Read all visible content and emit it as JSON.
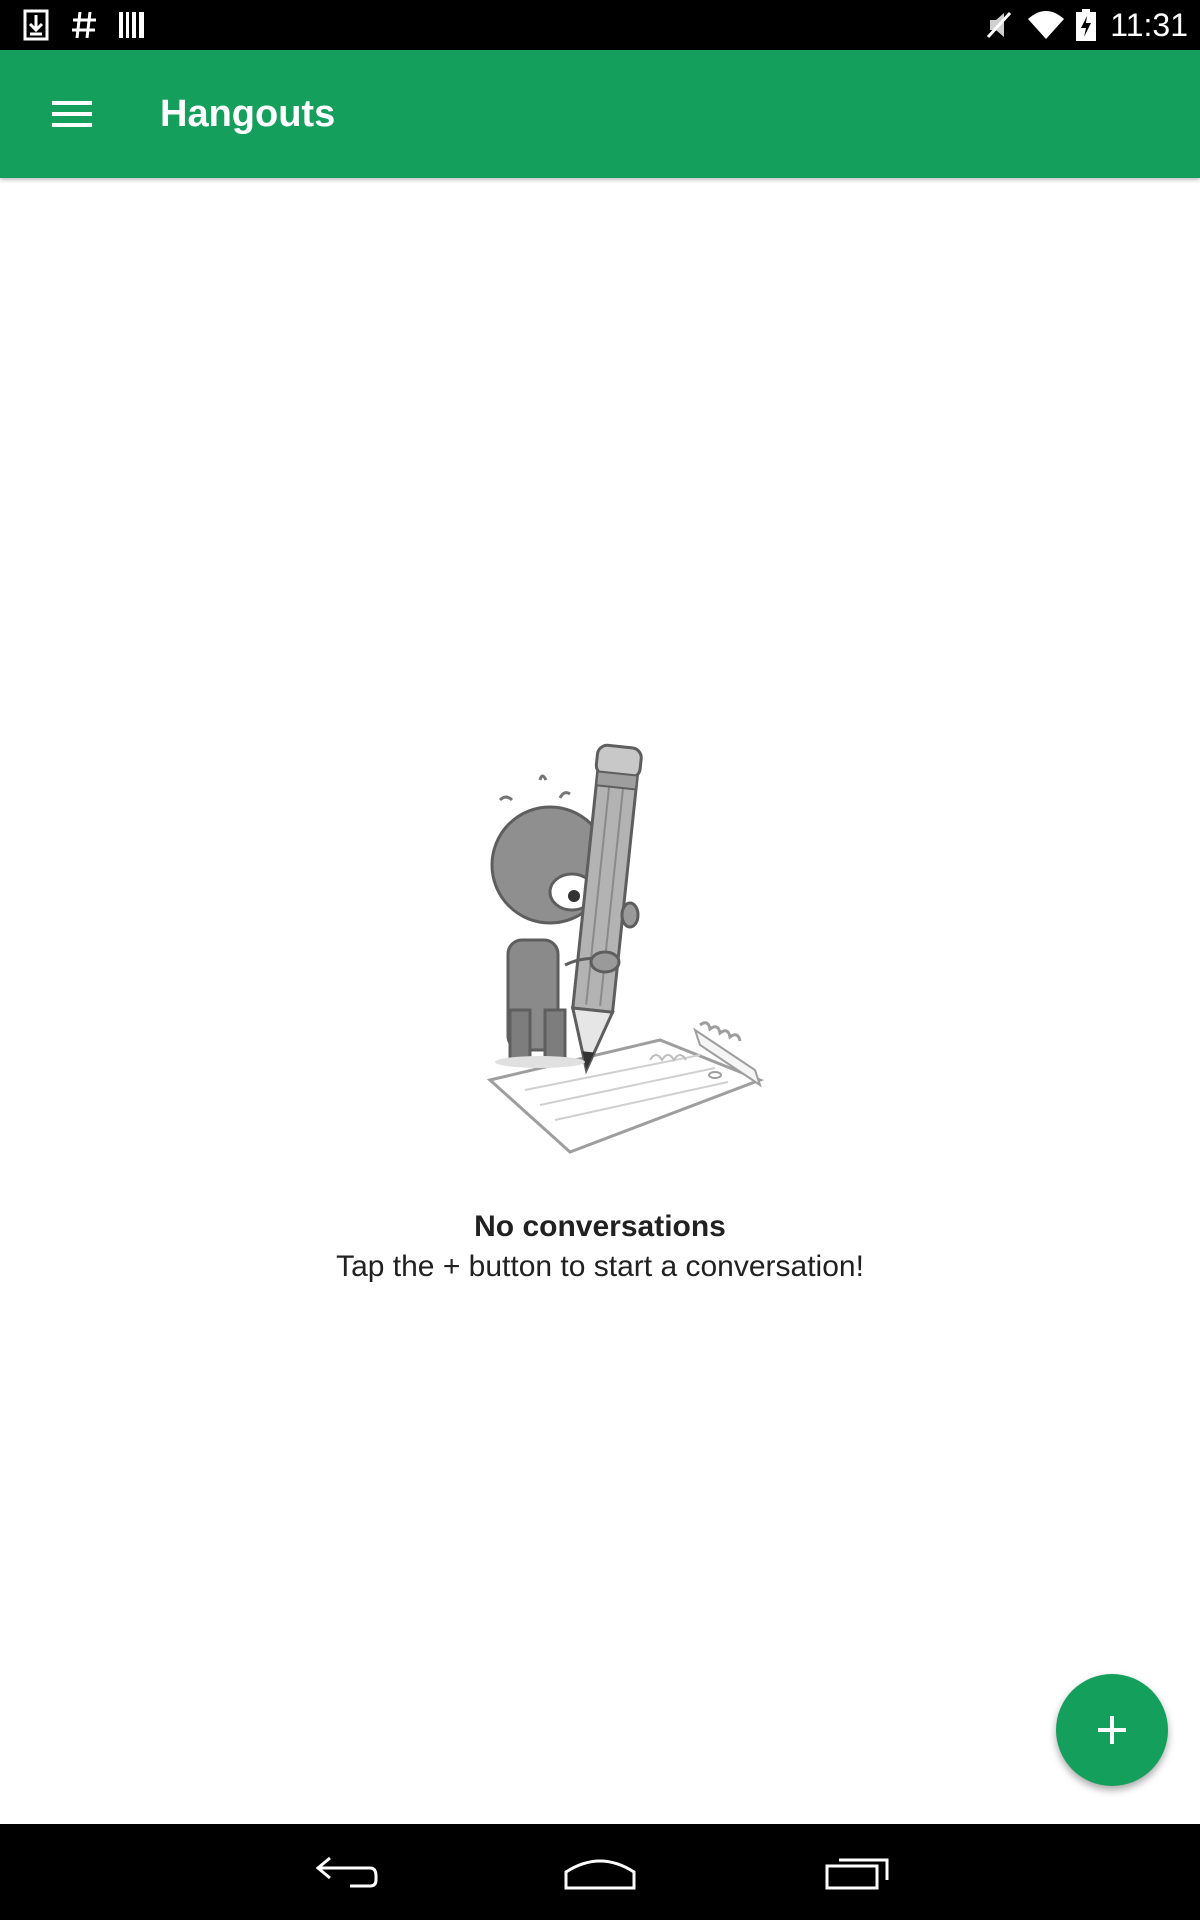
{
  "status_bar": {
    "time": "11:31",
    "left_icons": [
      "download-icon",
      "hash-icon",
      "barcode-icon"
    ],
    "right_icons": [
      "mute-icon",
      "wifi-icon",
      "battery-charging-icon"
    ]
  },
  "app_bar": {
    "title": "Hangouts",
    "menu_icon": "hamburger-menu-icon",
    "color": "#159f5c"
  },
  "empty_state": {
    "title": "No conversations",
    "subtitle": "Tap the + button to start a conversation!",
    "illustration": "character-with-pencil-illustration"
  },
  "fab": {
    "icon": "plus-icon",
    "color": "#159f5c"
  },
  "nav_bar": {
    "buttons": [
      "back-icon",
      "home-icon",
      "recents-icon"
    ]
  }
}
